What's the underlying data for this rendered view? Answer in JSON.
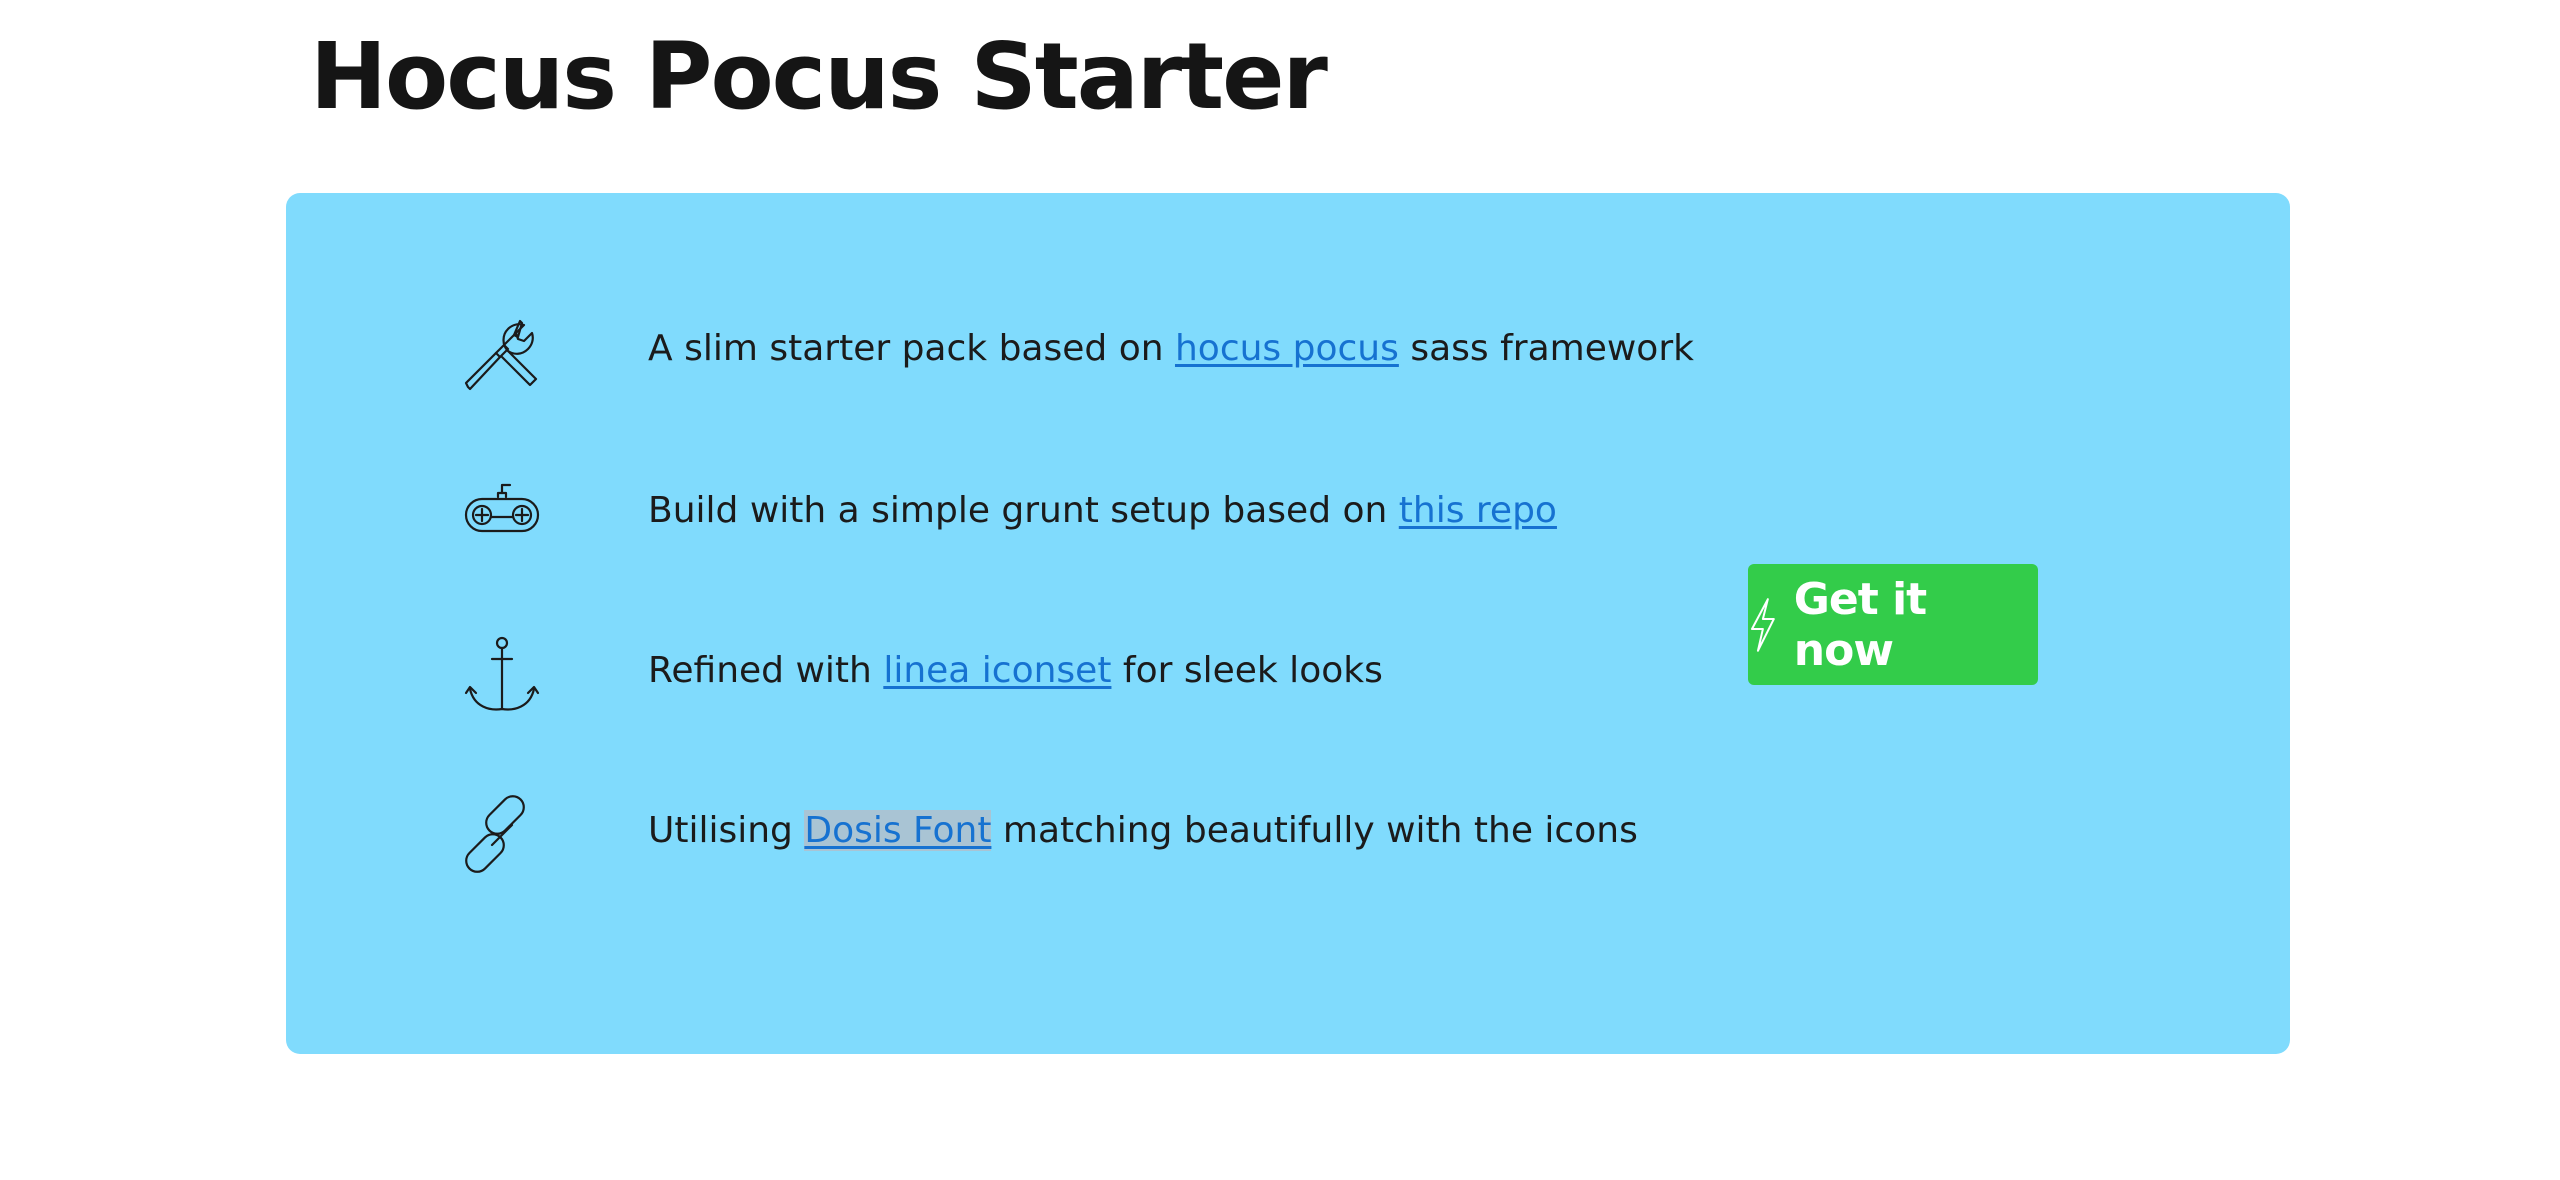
{
  "header": {
    "title": "Hocus Pocus Starter"
  },
  "features": [
    {
      "icon": "tools-icon",
      "before": "A slim starter pack based on ",
      "link": "hocus pocus",
      "after": " sass framework"
    },
    {
      "icon": "gamepad-icon",
      "before": "Build with a simple grunt setup based on ",
      "link": "this repo",
      "after": ""
    },
    {
      "icon": "anchor-icon",
      "before": "Refined with ",
      "link": "linea iconset",
      "after": " for sleek looks"
    },
    {
      "icon": "chain-link-icon",
      "before": "Utilising ",
      "link": "Dosis Font",
      "after": " matching beautifully with the icons"
    }
  ],
  "cta": {
    "label": "Get it now",
    "icon": "lightning-bolt-icon"
  },
  "colors": {
    "panel_background": "#80dbfd",
    "cta_background": "#33cc4a",
    "link": "#1672d1",
    "text": "#1b1b1b"
  }
}
